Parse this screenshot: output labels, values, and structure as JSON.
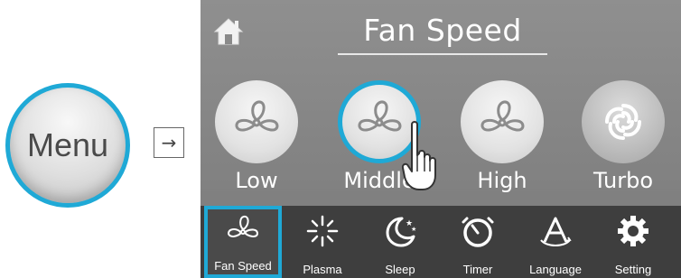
{
  "menu_button": {
    "label": "Menu"
  },
  "arrow": {
    "glyph": "→"
  },
  "screen": {
    "title": "Fan Speed",
    "speeds": [
      {
        "label": "Low",
        "icon": "fan-icon",
        "selected": false
      },
      {
        "label": "Middle",
        "icon": "fan-icon",
        "selected": true
      },
      {
        "label": "High",
        "icon": "fan-icon",
        "selected": false
      },
      {
        "label": "Turbo",
        "icon": "turbo-swirl-icon",
        "selected": false
      }
    ]
  },
  "bottom_nav": {
    "items": [
      {
        "label": "Fan Speed",
        "icon": "fan-icon",
        "active": true
      },
      {
        "label": "Plasma",
        "icon": "plasma-burst-icon",
        "active": false
      },
      {
        "label": "Sleep",
        "icon": "moon-stars-icon",
        "active": false
      },
      {
        "label": "Timer",
        "icon": "timer-icon",
        "active": false
      },
      {
        "label": "Language",
        "icon": "language-icon",
        "active": false
      },
      {
        "label": "Setting",
        "icon": "gear-icon",
        "active": false
      }
    ]
  },
  "colors": {
    "accent": "#1fa9d6",
    "screen_bg": "#8a8a8a",
    "nav_bg": "#3e3e3e",
    "icon_stroke": "#8c8c8c"
  }
}
